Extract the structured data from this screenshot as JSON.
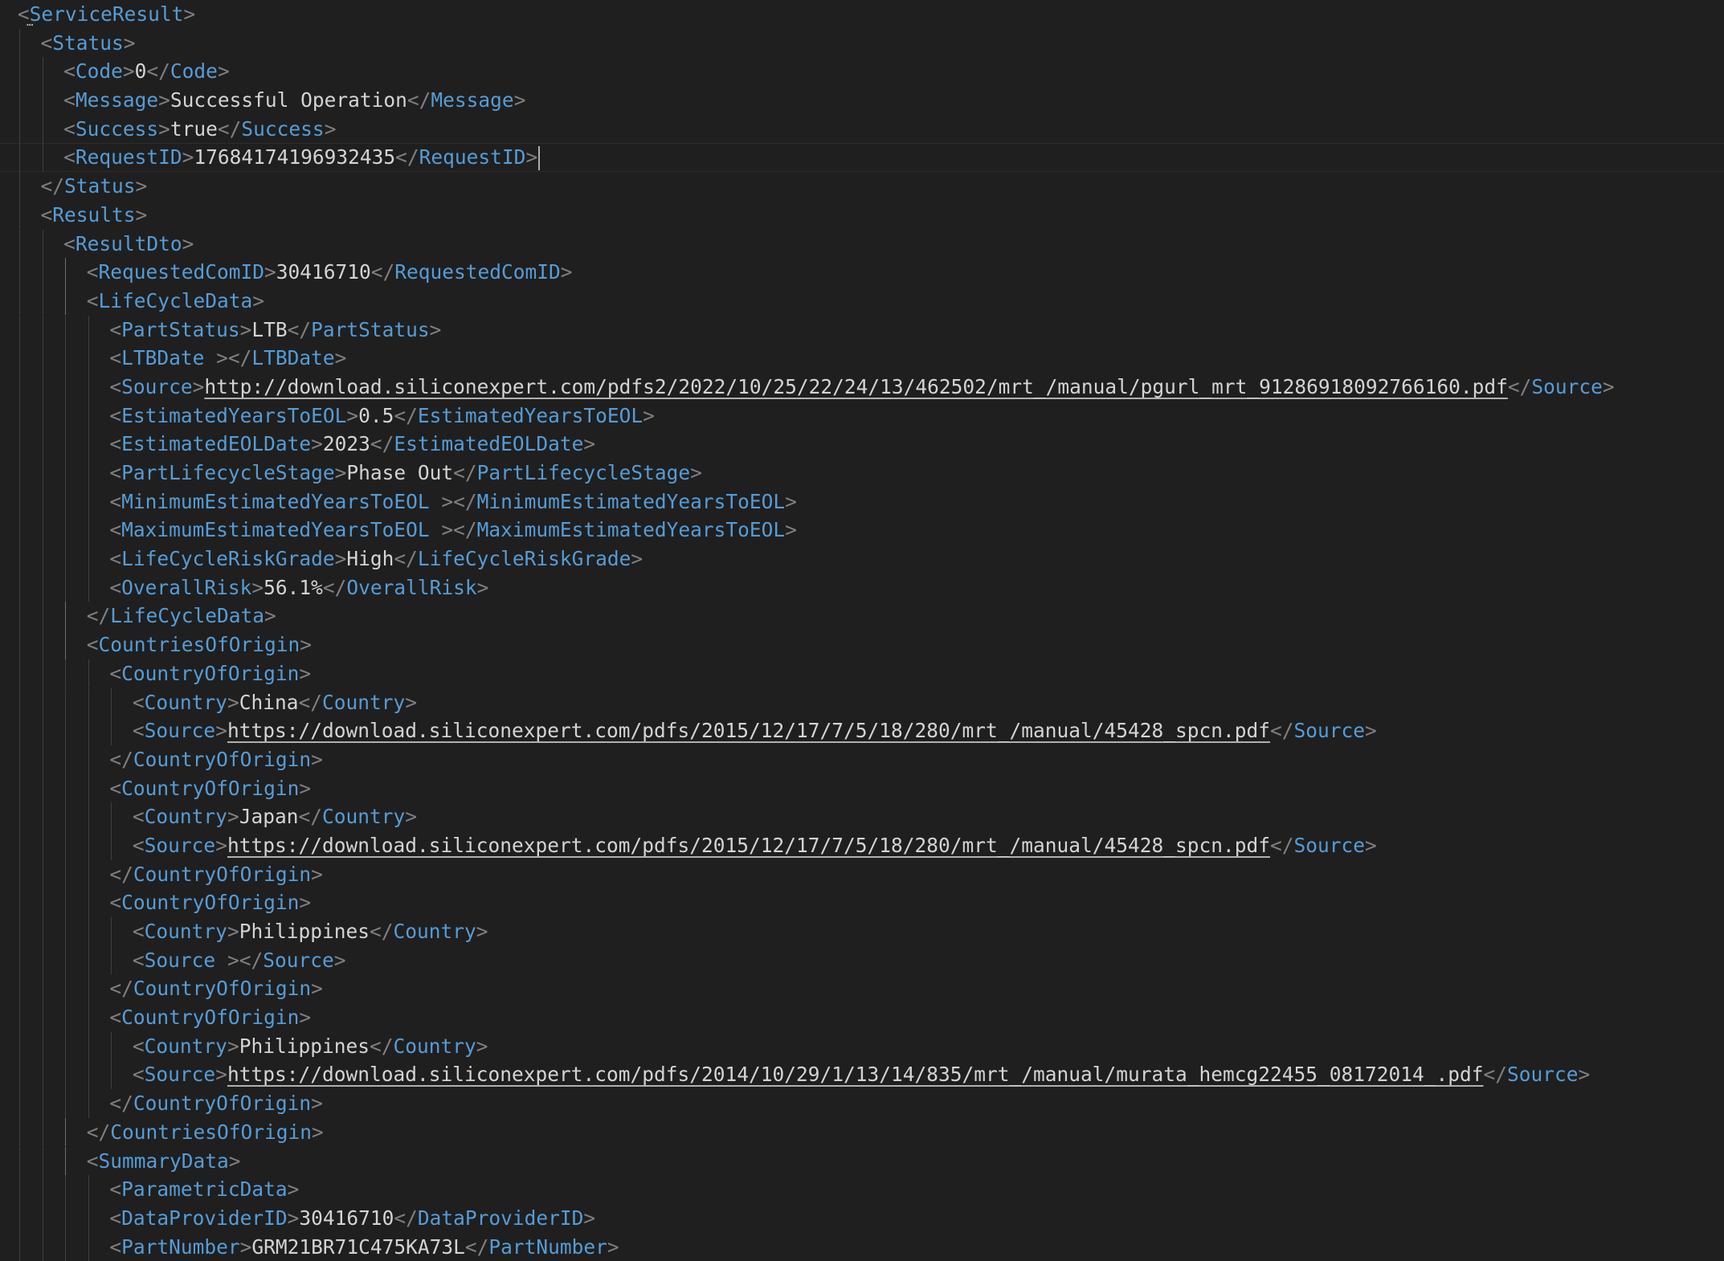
{
  "editor": {
    "language": "xml",
    "fold_indicator": "…",
    "lines": [
      {
        "indent": 0,
        "open": "ServiceResult",
        "text": null,
        "close": null
      },
      {
        "indent": 1,
        "open": "Status",
        "text": null,
        "close": null
      },
      {
        "indent": 2,
        "open": "Code",
        "text": "0",
        "close": "Code"
      },
      {
        "indent": 2,
        "open": "Message",
        "text": "Successful Operation",
        "close": "Message"
      },
      {
        "indent": 2,
        "open": "Success",
        "text": "true",
        "close": "Success"
      },
      {
        "indent": 2,
        "open": "RequestID",
        "text": "17684174196932435",
        "close": "RequestID",
        "cursor": true
      },
      {
        "indent": 1,
        "open": null,
        "text": null,
        "close": "Status"
      },
      {
        "indent": 1,
        "open": "Results",
        "text": null,
        "close": null
      },
      {
        "indent": 2,
        "open": "ResultDto",
        "text": null,
        "close": null
      },
      {
        "indent": 3,
        "open": "RequestedComID",
        "text": "30416710",
        "close": "RequestedComID"
      },
      {
        "indent": 3,
        "open": "LifeCycleData",
        "text": null,
        "close": null
      },
      {
        "indent": 4,
        "open": "PartStatus",
        "text": "LTB",
        "close": "PartStatus"
      },
      {
        "indent": 4,
        "open": "LTBDate ",
        "text": "",
        "close": "LTBDate"
      },
      {
        "indent": 4,
        "open": "Source",
        "text": "http://download.siliconexpert.com/pdfs2/2022/10/25/22/24/13/462502/mrt_/manual/pgurl_mrt_91286918092766160.pdf",
        "close": "Source",
        "link": true
      },
      {
        "indent": 4,
        "open": "EstimatedYearsToEOL",
        "text": "0.5",
        "close": "EstimatedYearsToEOL"
      },
      {
        "indent": 4,
        "open": "EstimatedEOLDate",
        "text": "2023",
        "close": "EstimatedEOLDate"
      },
      {
        "indent": 4,
        "open": "PartLifecycleStage",
        "text": "Phase Out",
        "close": "PartLifecycleStage"
      },
      {
        "indent": 4,
        "open": "MinimumEstimatedYearsToEOL ",
        "text": "",
        "close": "MinimumEstimatedYearsToEOL"
      },
      {
        "indent": 4,
        "open": "MaximumEstimatedYearsToEOL ",
        "text": "",
        "close": "MaximumEstimatedYearsToEOL"
      },
      {
        "indent": 4,
        "open": "LifeCycleRiskGrade",
        "text": "High",
        "close": "LifeCycleRiskGrade"
      },
      {
        "indent": 4,
        "open": "OverallRisk",
        "text": "56.1%",
        "close": "OverallRisk"
      },
      {
        "indent": 3,
        "open": null,
        "text": null,
        "close": "LifeCycleData"
      },
      {
        "indent": 3,
        "open": "CountriesOfOrigin",
        "text": null,
        "close": null
      },
      {
        "indent": 4,
        "open": "CountryOfOrigin",
        "text": null,
        "close": null
      },
      {
        "indent": 5,
        "open": "Country",
        "text": "China",
        "close": "Country"
      },
      {
        "indent": 5,
        "open": "Source",
        "text": "https://download.siliconexpert.com/pdfs/2015/12/17/7/5/18/280/mrt_/manual/45428_spcn.pdf",
        "close": "Source",
        "link": true
      },
      {
        "indent": 4,
        "open": null,
        "text": null,
        "close": "CountryOfOrigin"
      },
      {
        "indent": 4,
        "open": "CountryOfOrigin",
        "text": null,
        "close": null
      },
      {
        "indent": 5,
        "open": "Country",
        "text": "Japan",
        "close": "Country"
      },
      {
        "indent": 5,
        "open": "Source",
        "text": "https://download.siliconexpert.com/pdfs/2015/12/17/7/5/18/280/mrt_/manual/45428_spcn.pdf",
        "close": "Source",
        "link": true
      },
      {
        "indent": 4,
        "open": null,
        "text": null,
        "close": "CountryOfOrigin"
      },
      {
        "indent": 4,
        "open": "CountryOfOrigin",
        "text": null,
        "close": null
      },
      {
        "indent": 5,
        "open": "Country",
        "text": "Philippines",
        "close": "Country"
      },
      {
        "indent": 5,
        "open": "Source ",
        "text": "",
        "close": "Source"
      },
      {
        "indent": 4,
        "open": null,
        "text": null,
        "close": "CountryOfOrigin"
      },
      {
        "indent": 4,
        "open": "CountryOfOrigin",
        "text": null,
        "close": null
      },
      {
        "indent": 5,
        "open": "Country",
        "text": "Philippines",
        "close": "Country"
      },
      {
        "indent": 5,
        "open": "Source",
        "text": "https://download.siliconexpert.com/pdfs/2014/10/29/1/13/14/835/mrt_/manual/murata_hemcg22455_08172014_.pdf",
        "close": "Source",
        "link": true
      },
      {
        "indent": 4,
        "open": null,
        "text": null,
        "close": "CountryOfOrigin"
      },
      {
        "indent": 3,
        "open": null,
        "text": null,
        "close": "CountriesOfOrigin"
      },
      {
        "indent": 3,
        "open": "SummaryData",
        "text": null,
        "close": null
      },
      {
        "indent": 4,
        "open": "ParametricData",
        "text": null,
        "close": null
      },
      {
        "indent": 4,
        "open": "DataProviderID",
        "text": "30416710",
        "close": "DataProviderID"
      },
      {
        "indent": 4,
        "open": "PartNumber",
        "text": "GRM21BR71C475KA73L",
        "close": "PartNumber"
      }
    ]
  },
  "colors": {
    "background": "#1f1f1f",
    "tag": "#569cd6",
    "punctuation": "#808080",
    "text": "#d4d4d4",
    "indent_guide": "#404040",
    "active_guide": "#707070"
  }
}
